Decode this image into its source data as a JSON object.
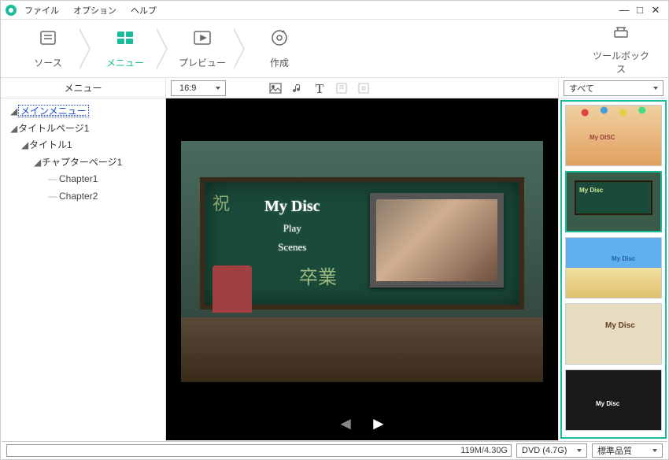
{
  "menubar": {
    "file": "ファイル",
    "option": "オプション",
    "help": "ヘルプ"
  },
  "window": {
    "min": "—",
    "max": "□",
    "close": "✕"
  },
  "steps": {
    "source": "ソース",
    "menu": "メニュー",
    "preview": "プレビュー",
    "create": "作成",
    "toolbox": "ツールボックス"
  },
  "sidebar": {
    "header": "メニュー",
    "tree": {
      "root": "メインメニュー",
      "title_page": "タイトルページ1",
      "title": "タイトル1",
      "chapter_page": "チャプターページ1",
      "chapter1": "Chapter1",
      "chapter2": "Chapter2"
    }
  },
  "toolbar": {
    "aspect": "16:9"
  },
  "preview": {
    "title": "My Disc",
    "play": "Play",
    "scenes": "Scenes",
    "kanji": "卒業"
  },
  "filter": {
    "all": "すべて"
  },
  "templates": {
    "t0_label": "My DISC",
    "t1_label": "My Disc",
    "t2_label": "My Disc",
    "t3_label": "My Disc",
    "t4_label": "My Disc"
  },
  "bottom": {
    "size": "119M/4.30G",
    "disc": "DVD (4.7G)",
    "quality": "標準品質"
  }
}
